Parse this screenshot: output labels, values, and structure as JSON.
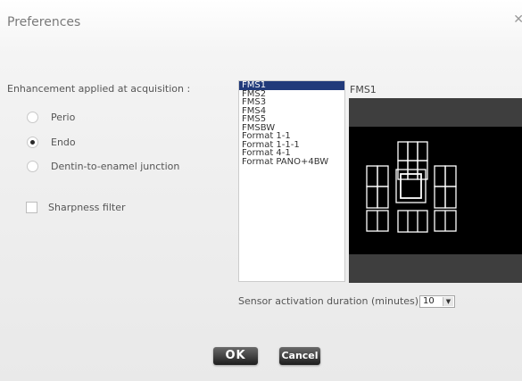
{
  "dialog": {
    "title": "Preferences"
  },
  "enhancement": {
    "label": "Enhancement applied at acquisition :",
    "options": [
      {
        "label": "Perio",
        "checked": false
      },
      {
        "label": "Endo",
        "checked": true
      },
      {
        "label": "Dentin-to-enamel junction",
        "checked": false
      }
    ]
  },
  "sharpness": {
    "label": "Sharpness filter",
    "checked": false
  },
  "templates": {
    "selected": "FMS1",
    "items": [
      "FMS1",
      "FMS2",
      "FMS3",
      "FMS4",
      "FMS5",
      "FMSBW",
      "Format 1-1",
      "Format 1-1-1",
      "Format 4-1",
      "Format PANO+4BW"
    ]
  },
  "preview": {
    "label": "FMS1"
  },
  "sensor": {
    "label": "Sensor activation duration (minutes) :",
    "value": "10"
  },
  "buttons": {
    "ok": "OK",
    "cancel": "Cancel"
  },
  "colors": {
    "selection": "#213a7a",
    "preview_bg": "#3e3e3e",
    "button": "#2a2a2a"
  }
}
